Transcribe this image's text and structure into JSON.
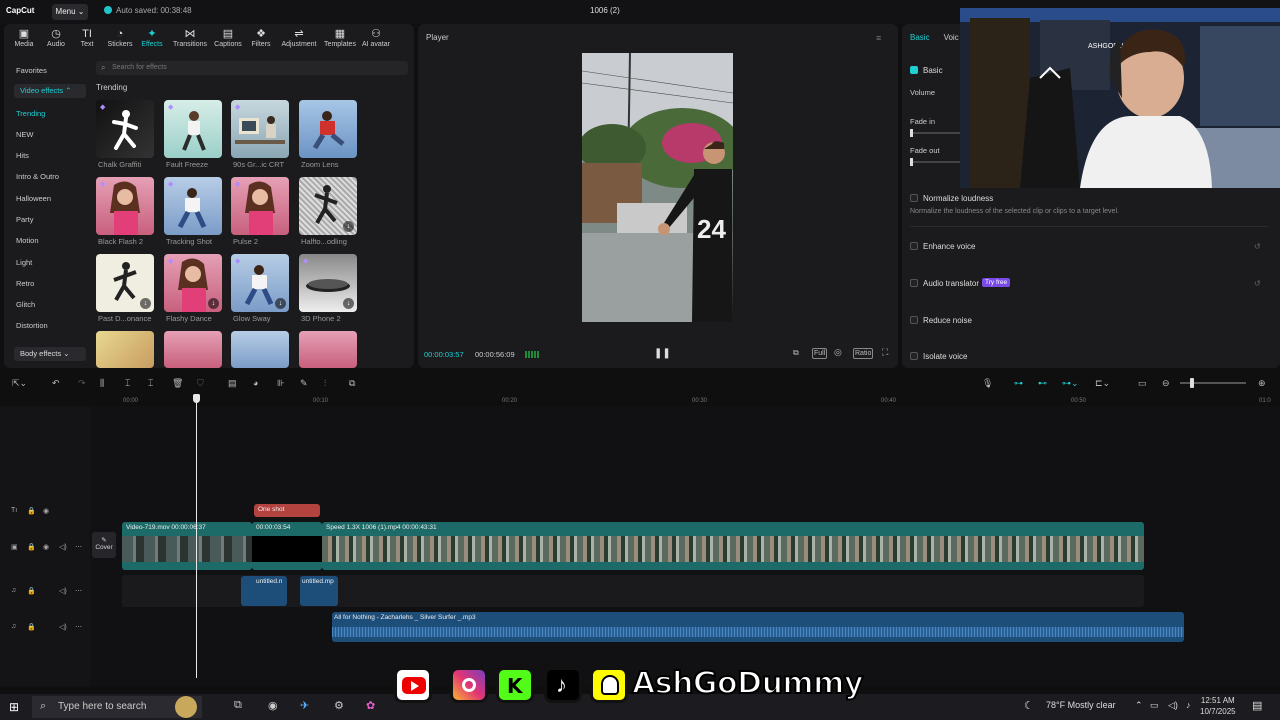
{
  "app": {
    "logo": "CapCut",
    "menu_label": "Menu ⌄",
    "autosave": "Auto saved: 00:38:48",
    "project_title": "1006 (2)"
  },
  "toolbar": {
    "items": [
      {
        "icon": "media-icon",
        "label": "Media"
      },
      {
        "icon": "audio-icon",
        "label": "Audio"
      },
      {
        "icon": "text-icon",
        "label": "Text"
      },
      {
        "icon": "stickers-icon",
        "label": "Stickers"
      },
      {
        "icon": "effects-icon",
        "label": "Effects"
      },
      {
        "icon": "transitions-icon",
        "label": "Transitions"
      },
      {
        "icon": "captions-icon",
        "label": "Captions"
      },
      {
        "icon": "filters-icon",
        "label": "Filters"
      },
      {
        "icon": "adjustment-icon",
        "label": "Adjustment"
      },
      {
        "icon": "templates-icon",
        "label": "Templates"
      },
      {
        "icon": "ai-avatar-icon",
        "label": "AI avatar"
      }
    ],
    "active": "Effects"
  },
  "sidebar": {
    "favorites": "Favorites",
    "video_effects": "Video effects",
    "categories": [
      "Trending",
      "NEW",
      "Hits",
      "Intro & Outro",
      "Halloween",
      "Party",
      "Motion",
      "Light",
      "Retro",
      "Glitch",
      "Distortion"
    ],
    "body_effects": "Body effects"
  },
  "effects": {
    "search_placeholder": "Search for effects",
    "section_title": "Trending",
    "items": [
      {
        "name": "Chalk Graffiti"
      },
      {
        "name": "Fault Freeze"
      },
      {
        "name": "90s Gr...ic CRT"
      },
      {
        "name": "Zoom Lens"
      },
      {
        "name": "Black Flash 2"
      },
      {
        "name": "Tracking Shot"
      },
      {
        "name": "Pulse 2"
      },
      {
        "name": "Halfto...odling"
      },
      {
        "name": "Past D...onance"
      },
      {
        "name": "Flashy Dance"
      },
      {
        "name": "Glow Sway"
      },
      {
        "name": "3D Phone 2"
      }
    ]
  },
  "player": {
    "title": "Player",
    "current_time": "00:00:03:57",
    "total_time": "00:00:56:09",
    "controls": [
      "Full",
      "Ratio"
    ]
  },
  "right_panel": {
    "tabs": [
      "Basic",
      "Voic"
    ],
    "basic_label": "Basic",
    "volume_label": "Volume",
    "fade_in": "Fade in",
    "fade_out": "Fade out",
    "options": [
      {
        "label": "Normalize loudness",
        "desc": "Normalize the loudness of the selected clip or clips to a target level."
      },
      {
        "label": "Enhance voice"
      },
      {
        "label": "Audio translator",
        "badge": "Try free"
      },
      {
        "label": "Reduce noise"
      },
      {
        "label": "Isolate voice"
      }
    ]
  },
  "ruler": [
    "00:00",
    "00:10",
    "00:20",
    "00:30",
    "00:40",
    "00:50",
    "01:0"
  ],
  "timeline": {
    "cover_label": "Cover",
    "text_clip": "One shot",
    "clip1": "Video-719.mov  00:00:06:37",
    "clip2": "00:00:03:54",
    "clip3": "Speed 1.3X  1006 (1).mp4  00:00:43:31",
    "audio1": "untitled.n",
    "audio2": "untitled.mp",
    "music": "All for Nothing - Zacharlehs _ Silver Surfer _.mp3"
  },
  "taskbar": {
    "search_placeholder": "Type here to search",
    "weather": "78°F  Mostly clear",
    "time": "12:51 AM",
    "date": "10/7/2025"
  },
  "overlay": {
    "channel": "AshGoDummy"
  },
  "colors": {
    "accent": "#1ed0d4",
    "clip_teal": "#1d6b68",
    "audio_blue": "#1d4e7a",
    "text_clip": "#b3433f"
  }
}
